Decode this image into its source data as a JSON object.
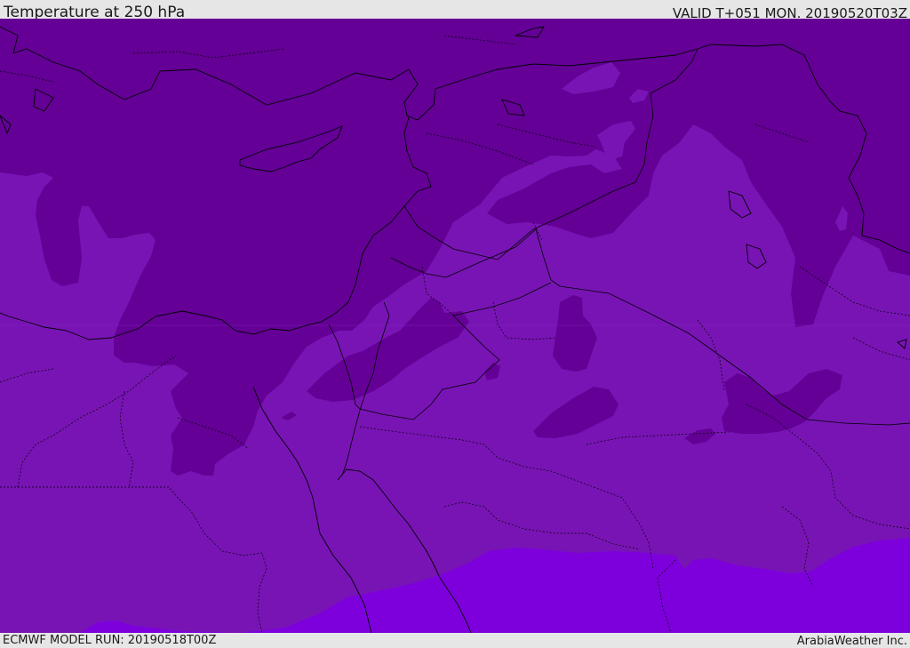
{
  "header": {
    "title": "Temperature at 250 hPa",
    "valid": "VALID T+051 MON. 20190520T03Z"
  },
  "footer": {
    "model_run": "ECMWF MODEL RUN: 20190518T00Z",
    "credit": "ArabiaWeather Inc."
  },
  "map": {
    "field": "temperature",
    "level_hpa": 250,
    "region": "Eastern Mediterranean / Middle East",
    "colors": {
      "coldest_band": "#640096",
      "mid_band": "#7814b4",
      "warmest_band": "#7d00dc",
      "border_line": "#000000"
    }
  }
}
